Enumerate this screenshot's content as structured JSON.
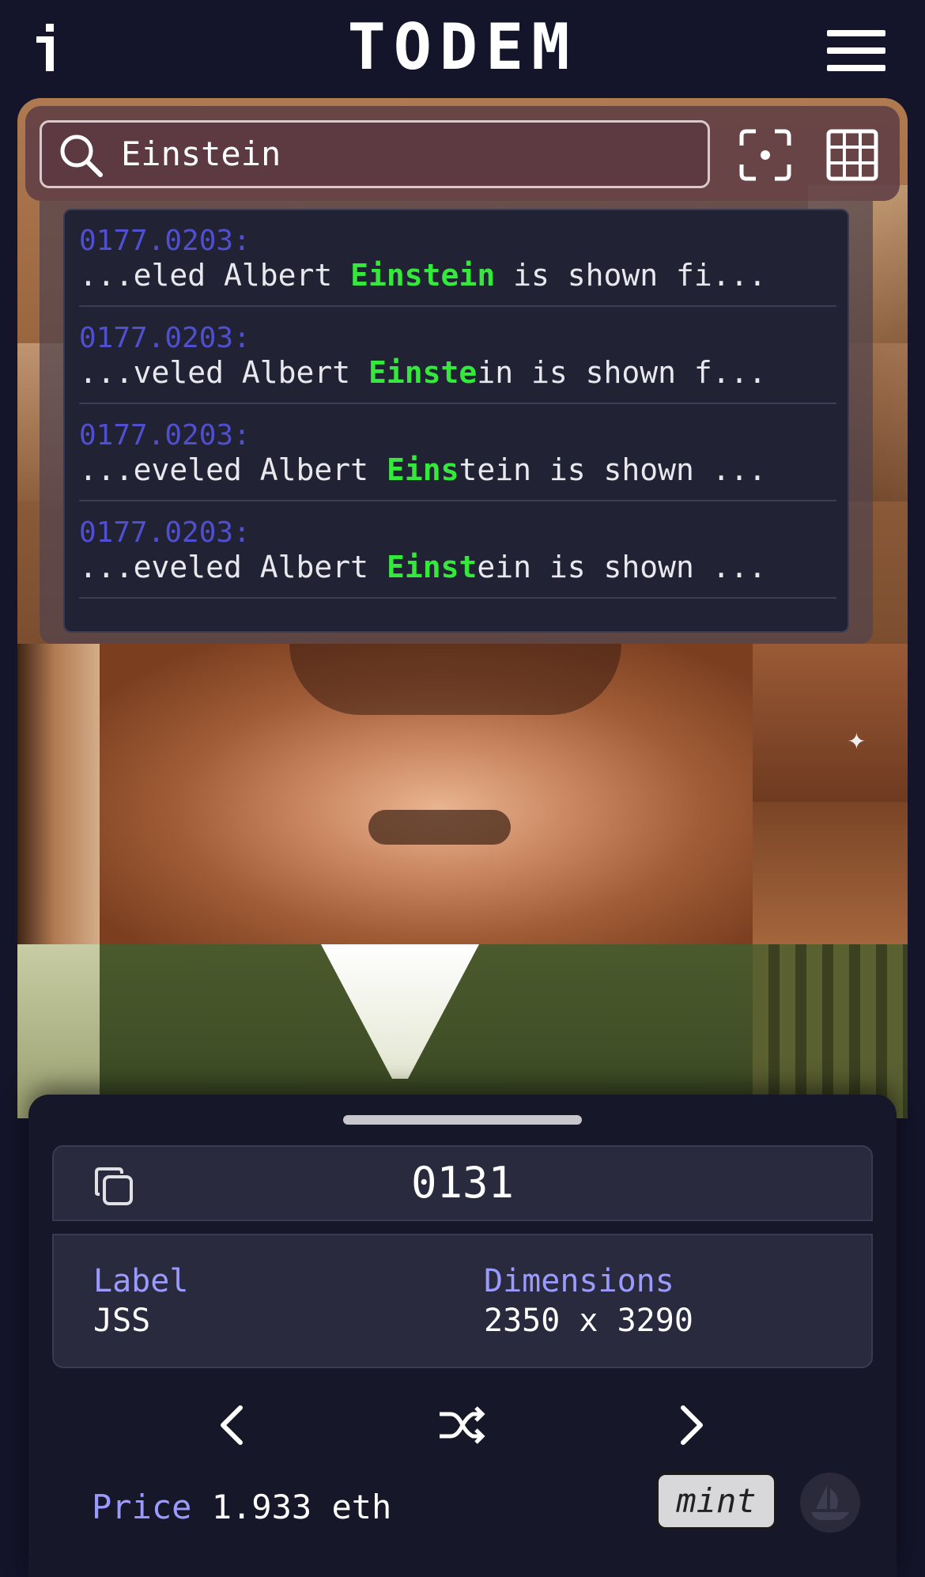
{
  "header": {
    "logo": "TODEM",
    "info_icon": "info-icon",
    "menu_icon": "hamburger-menu-icon"
  },
  "search": {
    "value": "Einstein",
    "placeholder": "",
    "search_icon": "search-icon",
    "scan_icon": "focus-scan-icon",
    "grid_icon": "grid-icon"
  },
  "results": [
    {
      "id": "0177.0203:",
      "before": "...eled Albert ",
      "match": "Einstein",
      "after": " is shown fi..."
    },
    {
      "id": "0177.0203:",
      "before": "...veled Albert ",
      "match": "Einste",
      "after": "in is shown f..."
    },
    {
      "id": "0177.0203:",
      "before": "...eveled Albert ",
      "match": "Eins",
      "after": "tein is shown ..."
    },
    {
      "id": "0177.0203:",
      "before": "...eveled Albert ",
      "match": "Einst",
      "after": "ein is shown ..."
    }
  ],
  "detail": {
    "token_id": "0131",
    "copy_icon": "copy-icon",
    "label_key": "Label",
    "label_value": "JSS",
    "dimensions_key": "Dimensions",
    "dimensions_value": "2350 x 3290",
    "prev_icon": "chevron-left-icon",
    "shuffle_icon": "shuffle-icon",
    "next_icon": "chevron-right-icon",
    "price_key": "Price",
    "price_value": "1.933 eth",
    "mint_label": "mint",
    "opensea_icon": "opensea-ship-icon"
  },
  "colors": {
    "background": "#14142a",
    "panel": "#2a2a3e",
    "accent_key": "#9b9bff",
    "result_id": "#4f4fd0",
    "highlight": "#34e83c"
  }
}
